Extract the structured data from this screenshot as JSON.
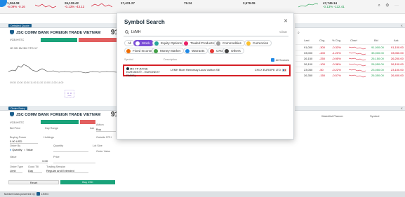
{
  "ticker_strip": [
    {
      "value": "1,264.08",
      "change": "-6.09% -0.16",
      "tone": "neg"
    },
    {
      "value": "26,138.42",
      "change": "-0.13% -43.12",
      "tone": "neg"
    },
    {
      "value": "17,431.27",
      "change": "",
      "tone": "neg"
    },
    {
      "value": "79.24",
      "change": "",
      "tone": "neg"
    },
    {
      "value": "2,579.09",
      "change": "",
      "tone": "neg"
    },
    {
      "value": "47,745.14",
      "change": "-0.13% -122.41",
      "tone": "pos"
    }
  ],
  "left_panel_top": {
    "tab": "Detailed Quote",
    "title": "JSC COMM BANK FOREIGN TRADE VIETNAM",
    "code": "VCB.HSTC",
    "price": "91,2",
    "toolbar": "1D 5D 1M 3M YTD 1Y",
    "axis": "09:30 10:00 10:30 11:00 11:30 13:00 13:30 14:00"
  },
  "left_panel_bottom": {
    "tab": "Order Entry",
    "title": "JSC COMM BANK FOREIGN TRADE VIETNAM",
    "code": "VCB.HSTC",
    "price": "91,2",
    "labels": {
      "bid": "Bid Price",
      "day_range": "Day Range",
      "ask": "Ask",
      "action": "Action",
      "buy": "Buy",
      "buying_power": "Buying Power",
      "buying_power_val": "0.00 USD",
      "holdings": "Holdings",
      "outside_rth": "Outside RTH",
      "order_by": "Order By",
      "quantity_opt": "Quantity",
      "value_opt": "Value",
      "quantity": "Quantity",
      "lot_size": "Lot Size",
      "order_value": "Order Value",
      "value": "Value",
      "value_val": "0.00",
      "price": "Price",
      "order_type": "Order Type",
      "order_type_val": "Limit",
      "good_till": "Good Till",
      "good_till_val": "Day",
      "trading_session": "Trading Session",
      "session_val": "Regular and Extended",
      "reset": "Reset",
      "buy_btn": "Buy JSC"
    }
  },
  "right_table": {
    "headers": [
      "Last",
      "Chg.",
      "% Chg.",
      "Chart",
      "Bid",
      "Ask"
    ],
    "rows": [
      {
        "last": "91,000",
        "chg": "-300",
        "pct": "-0.33%",
        "bid": "91,000.00",
        "ask": "91,100.00"
      },
      {
        "last": "33,000",
        "chg": "-400",
        "pct": "-1.20%",
        "bid": "33,000.00",
        "ask": "33,050.00"
      },
      {
        "last": "26,150",
        "chg": "-250",
        "pct": "-0.95%",
        "bid": "26,150.00",
        "ask": "26,200.00"
      },
      {
        "last": "26,100",
        "chg": "-100",
        "pct": "-0.38%",
        "bid": "26,050.00",
        "ask": "26,100.00"
      },
      {
        "last": "23,050",
        "chg": "-50",
        "pct": "-0.22%",
        "bid": "23,050.00",
        "ask": "23,100.00"
      },
      {
        "last": "26,350",
        "chg": "-150",
        "pct": "-0.57%",
        "bid": "26,350.00",
        "ask": "26,400.00"
      }
    ],
    "bottom_cols": [
      "Watchlist Planner",
      "Symbol"
    ]
  },
  "modal": {
    "title": "Symbol Search",
    "search_value": "LVMH",
    "clear": "Clear",
    "chips": [
      "All",
      "Stock",
      "Equity Options",
      "Traded Products",
      "Commodities",
      "Currencies",
      "Fixed Income",
      "Money Market",
      "Warrants",
      "CFD",
      "Others"
    ],
    "columns": {
      "symbol": "Symbol",
      "description": "Description",
      "all_sources": "All Sources"
    },
    "result": {
      "symbol": "MC FP (NYSE EURONEXT - EURONEXT PARIS)",
      "description": "LVMH Moet Hennessy Louis Vuitton SE",
      "exchange": "CHI-X EUROPE LTD"
    }
  },
  "footer": {
    "text": "Market Data powered by",
    "brand": "LSEG"
  },
  "colors": {
    "accent": "#7b4fd6",
    "highlight": "#d51f26",
    "brand": "#1b5e8c"
  }
}
